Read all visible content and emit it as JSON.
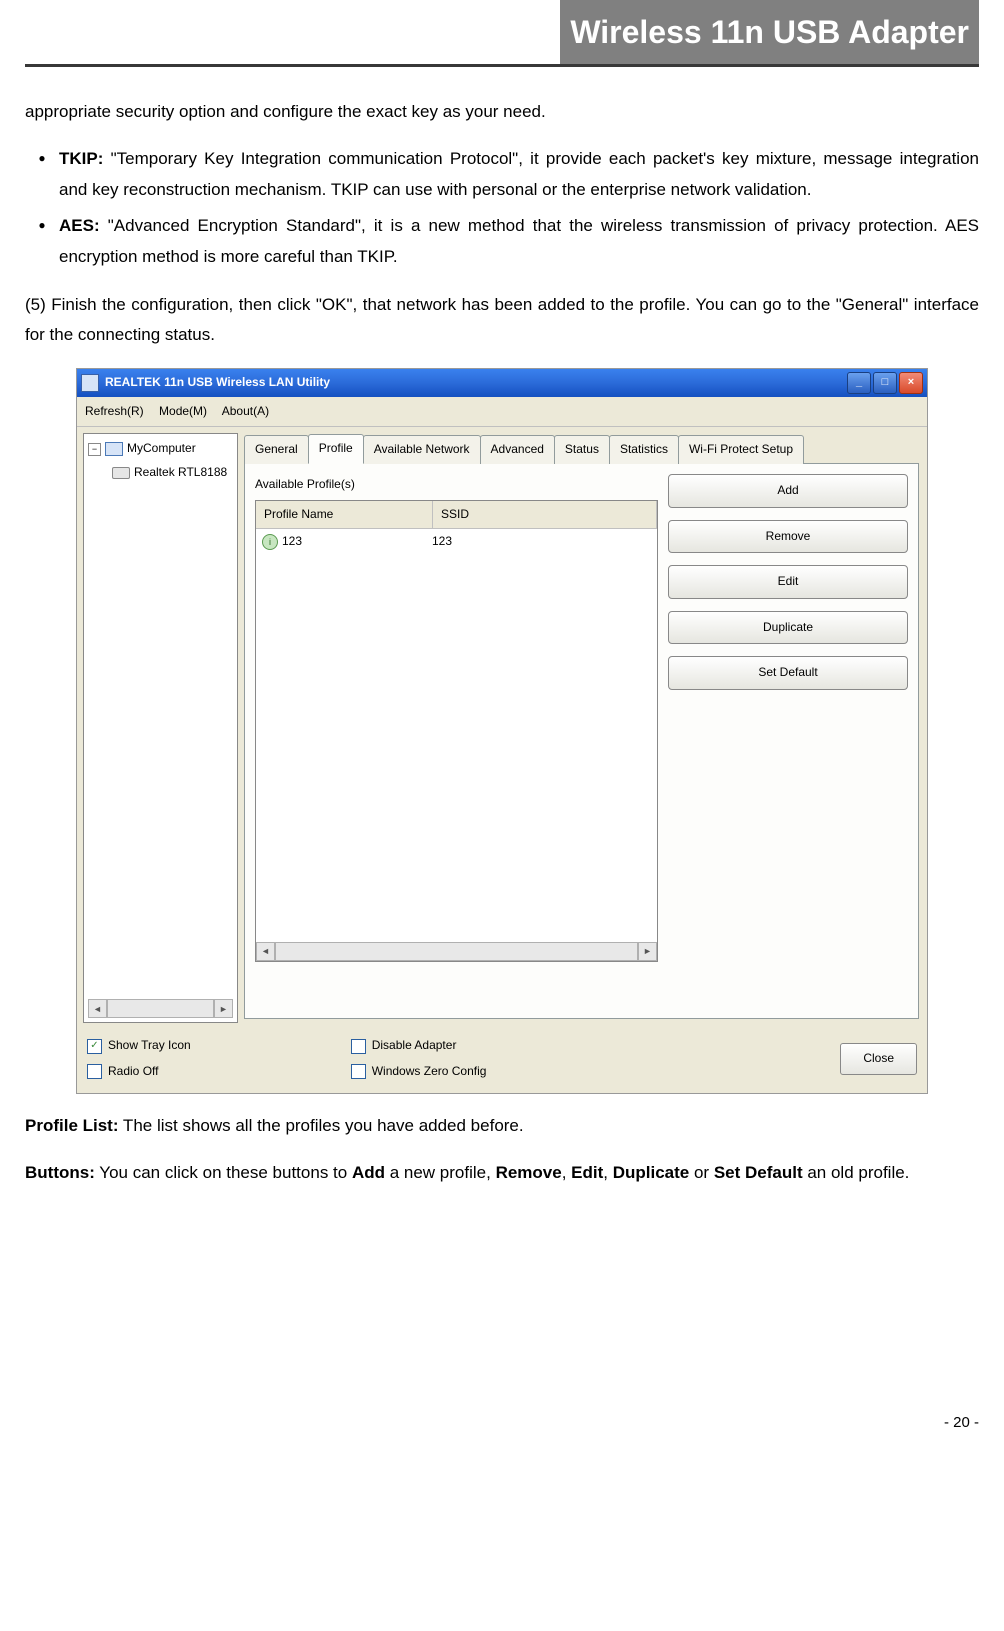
{
  "header": {
    "title": "Wireless 11n USB Adapter"
  },
  "intro": "appropriate security option and configure the exact key as your need.",
  "bullets": [
    {
      "term": "TKIP:",
      "text": " \"Temporary Key Integration communication Protocol\", it provide each packet's key mixture, message integration and key reconstruction mechanism. TKIP can use with personal or the enterprise network validation."
    },
    {
      "term": "AES:",
      "text": " \"Advanced Encryption Standard\", it is a new method that the wireless transmission of privacy protection. AES encryption method is more careful than TKIP."
    }
  ],
  "step5": " (5) Finish the configuration, then click \"OK\", that network has been added to the profile. You can go to the \"General\" interface for the connecting status.",
  "app": {
    "title": "REALTEK 11n USB Wireless LAN Utility",
    "menus": [
      "Refresh(R)",
      "Mode(M)",
      "About(A)"
    ],
    "tree": {
      "root": "MyComputer",
      "child": "Realtek RTL8188"
    },
    "tabs": [
      "General",
      "Profile",
      "Available Network",
      "Advanced",
      "Status",
      "Statistics",
      "Wi-Fi Protect Setup"
    ],
    "active_tab": 1,
    "list_label": "Available Profile(s)",
    "columns": [
      "Profile Name",
      "SSID"
    ],
    "rows": [
      {
        "name": "123",
        "ssid": "123"
      }
    ],
    "buttons": [
      "Add",
      "Remove",
      "Edit",
      "Duplicate",
      "Set Default"
    ],
    "opts": {
      "show_tray": {
        "label": "Show Tray Icon",
        "checked": true
      },
      "radio_off": {
        "label": "Radio Off",
        "checked": false
      },
      "disable_adapter": {
        "label": "Disable Adapter",
        "checked": false
      },
      "zero_config": {
        "label": "Windows Zero Config",
        "checked": false
      }
    },
    "close": "Close"
  },
  "after": {
    "profile_list_label": "Profile List:",
    "profile_list_text": " The list shows all the profiles you have added before.",
    "buttons_label": "Buttons:",
    "buttons_text_1": " You can click on these buttons to ",
    "buttons_text_2": " a new profile, ",
    "buttons_text_3": ", ",
    "buttons_text_4": ", ",
    "buttons_text_5": " or ",
    "buttons_text_6": " an old profile.",
    "b_add": "Add",
    "b_remove": "Remove",
    "b_edit": "Edit",
    "b_dup": "Duplicate",
    "b_set": "Set Default"
  },
  "page_num": "- 20 -"
}
